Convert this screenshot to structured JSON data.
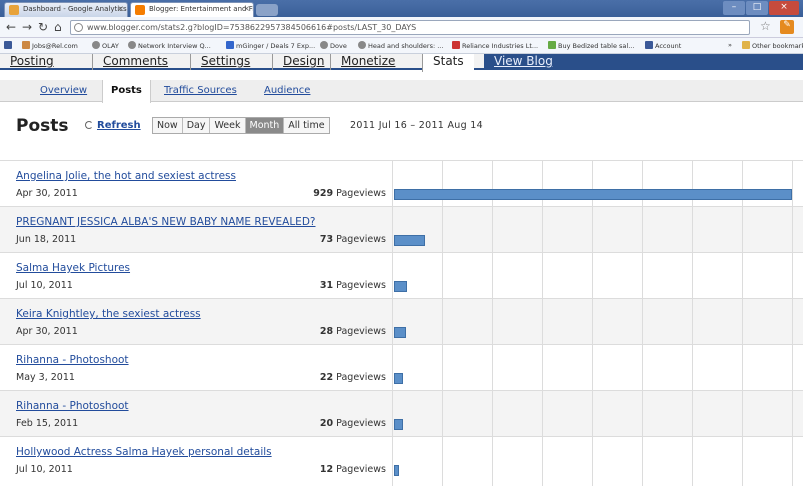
{
  "browser": {
    "tabs": [
      {
        "label": "Dashboard - Google Analytics",
        "active": false
      },
      {
        "label": "Blogger: Entertainment and Fi",
        "active": true
      }
    ],
    "url": "www.blogger.com/stats2.g?blogID=7538622957384506616#posts/LAST_30_DAYS",
    "bookmarks": [
      "Jobs@Rel.com",
      "OLAY",
      "Network Interview Q...",
      "mGinger / Deals 7 Exp...",
      "Dove",
      "Head and shoulders: ...",
      "Reliance Industries Lt...",
      "Buy Bedized table sal...",
      "Account",
      "Other bookmarks"
    ]
  },
  "blogger_nav": {
    "items": [
      "Posting",
      "Comments",
      "Settings",
      "Design",
      "Monetize",
      "Stats",
      "View Blog"
    ]
  },
  "sub_tabs": [
    "Overview",
    "Posts",
    "Traffic Sources",
    "Audience"
  ],
  "posts_header": {
    "title": "Posts",
    "refresh": "Refresh",
    "ranges": [
      "Now",
      "Day",
      "Week",
      "Month",
      "All time"
    ],
    "selected_range": "Month",
    "date_range": "2011 Jul 16 – 2011 Aug 14"
  },
  "posts": [
    {
      "title": "Angelina Jolie, the hot and sexiest actress",
      "date": "Apr 30, 2011",
      "views": 929,
      "views_label": "929",
      "unit": "Pageviews"
    },
    {
      "title": "PREGNANT JESSICA ALBA'S NEW BABY NAME REVEALED?",
      "date": "Jun 18, 2011",
      "views": 73,
      "views_label": "73",
      "unit": "Pageviews"
    },
    {
      "title": "Salma Hayek Pictures",
      "date": "Jul 10, 2011",
      "views": 31,
      "views_label": "31",
      "unit": "Pageviews"
    },
    {
      "title": "Keira Knightley, the sexiest actress",
      "date": "Apr 30, 2011",
      "views": 28,
      "views_label": "28",
      "unit": "Pageviews"
    },
    {
      "title": "Rihanna - Photoshoot",
      "date": "May 3, 2011",
      "views": 22,
      "views_label": "22",
      "unit": "Pageviews"
    },
    {
      "title": "Rihanna - Photoshoot",
      "date": "Feb 15, 2011",
      "views": 20,
      "views_label": "20",
      "unit": "Pageviews"
    },
    {
      "title": "Hollywood Actress Salma Hayek personal details",
      "date": "Jul 10, 2011",
      "views": 12,
      "views_label": "12",
      "unit": "Pageviews"
    }
  ],
  "colors": {
    "bar": "#5b8fc8",
    "link": "#224c9c",
    "nav_accent": "#2a4f8a"
  }
}
